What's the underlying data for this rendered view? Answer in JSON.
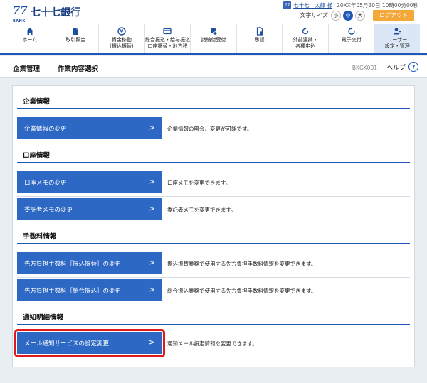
{
  "header": {
    "logo_mark": "77",
    "logo_bank": "BANK",
    "bank_name": "七十七銀行",
    "user_icon": "77",
    "user_name": "七十七　太郎 様",
    "last_login": "20XX年05月20日 10時00分00秒",
    "font_size_label": "文字サイズ",
    "font_sizes": [
      "小",
      "中",
      "大"
    ],
    "font_size_selected": "中",
    "logout_label": "ログアウト"
  },
  "nav": {
    "items": [
      {
        "label": "ホーム",
        "icon": "home-icon"
      },
      {
        "label": "取引照会",
        "icon": "document-icon"
      },
      {
        "label": "資金移動\n(振込振替)",
        "icon": "yen-transfer-icon"
      },
      {
        "label": "総合振込・給与振込\n口座振替・地方税",
        "icon": "card-icon"
      },
      {
        "label": "諸納付受付",
        "icon": "payment-icon"
      },
      {
        "label": "承認",
        "icon": "approval-icon"
      },
      {
        "label": "外部連携・\n各種申込",
        "icon": "link-icon"
      },
      {
        "label": "電子交付",
        "icon": "refresh-icon"
      },
      {
        "label": "ユーザー\n設定・管理",
        "icon": "user-settings-icon"
      }
    ],
    "active_index": 8
  },
  "titlebar": {
    "breadcrumb_1": "企業管理",
    "breadcrumb_2": "作業内容選択",
    "screen_id": "BKGK001",
    "help_label": "ヘルプ",
    "help_icon": "?"
  },
  "sections": [
    {
      "title": "企業情報",
      "actions": [
        {
          "label": "企業情報の変更",
          "description": "企業情報の照会、変更が可能です。"
        }
      ]
    },
    {
      "title": "口座情報",
      "actions": [
        {
          "label": "口座メモの変更",
          "description": "口座メモを変更できます。"
        },
        {
          "label": "委託者メモの変更",
          "description": "委託者メモを変更できます。"
        }
      ]
    },
    {
      "title": "手数料情報",
      "actions": [
        {
          "label": "先方負担手数料［振込振替］の変更",
          "description": "振込振替業務で使用する先方負担手数料情報を変更できます。"
        },
        {
          "label": "先方負担手数料［総合振込］の変更",
          "description": "総合振込業務で使用する先方負担手数料情報を変更できます。"
        }
      ]
    },
    {
      "title": "通知明細情報",
      "actions": [
        {
          "label": "メール通知サービスの設定変更",
          "description": "通知メール設定情報を変更できます。"
        }
      ]
    }
  ],
  "chevron": ">",
  "colors": {
    "brand_blue": "#1f57b8",
    "button_blue": "#2d68c4",
    "logout_orange": "#f4a83a",
    "highlight_red": "#e01a1a"
  }
}
